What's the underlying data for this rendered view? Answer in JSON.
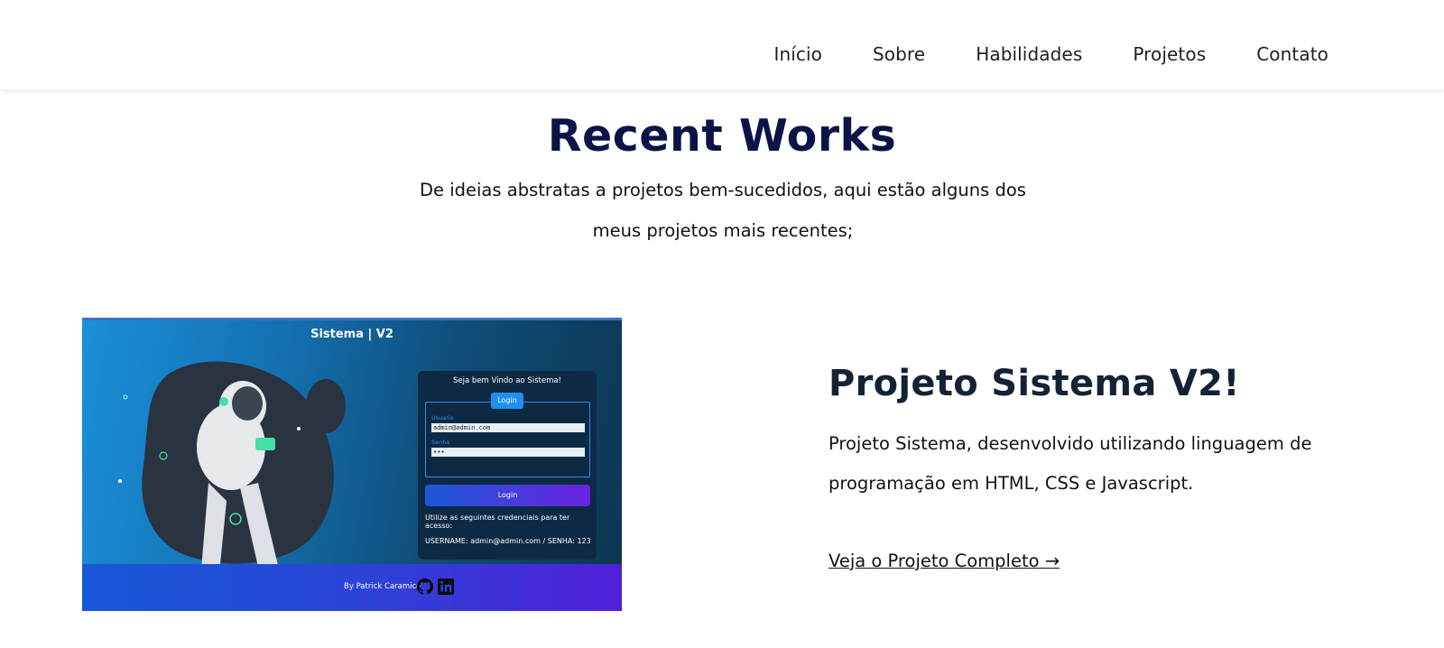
{
  "nav": {
    "items": [
      {
        "label": "Início"
      },
      {
        "label": "Sobre"
      },
      {
        "label": "Habilidades"
      },
      {
        "label": "Projetos"
      },
      {
        "label": "Contato"
      }
    ]
  },
  "section": {
    "title": "Recent Works",
    "subtitle": "De ideias abstratas a projetos bem-sucedidos, aqui estão alguns dos meus projetos mais recentes;"
  },
  "project": {
    "title": "Projeto Sistema V2!",
    "description": "Projeto Sistema, desenvolvido utilizando linguagem de programação em HTML, CSS e Javascript.",
    "link_label": "Veja o Projeto Completo →",
    "thumbnail": {
      "header": "Sistema | V2",
      "welcome": "Seja bem Vindo ao Sistema!",
      "tab_label": "Login",
      "user_label": "Usuario",
      "user_value": "admin@admin.com",
      "pass_label": "Senha",
      "pass_value": "•••",
      "button_label": "Login",
      "hint": "Utilize as seguintes credenciais para ter acesso:",
      "credentials": "USERNAME: admin@admin.com / SENHA: 123",
      "footer": "By Patrick Caramico",
      "footer_icons": [
        "github-icon",
        "linkedin-icon"
      ]
    }
  },
  "colors": {
    "title": "#0b1446",
    "project_title": "#142236",
    "thumb_bg_start": "#1a8fd8",
    "thumb_footer_end": "#5020d8"
  }
}
